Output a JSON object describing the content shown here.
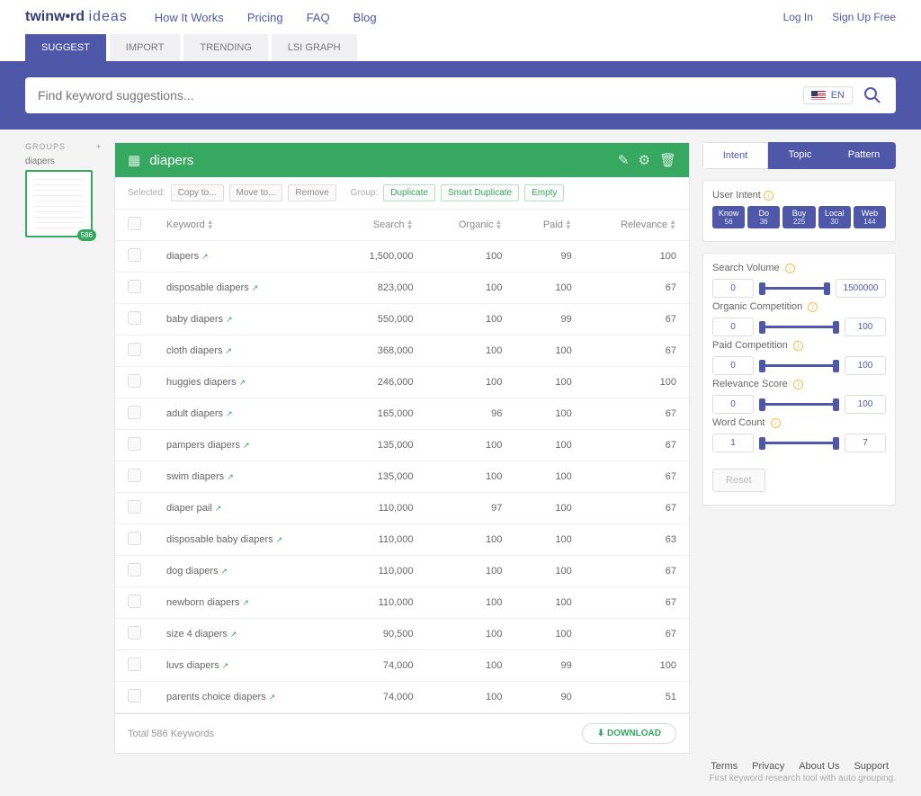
{
  "brand": {
    "name": "twinw•rd",
    "sub": "ideas"
  },
  "topnav": [
    "How It Works",
    "Pricing",
    "FAQ",
    "Blog"
  ],
  "auth": {
    "login": "Log In",
    "signup": "Sign Up Free"
  },
  "tabs": [
    "SUGGEST",
    "IMPORT",
    "TRENDING",
    "LSI GRAPH"
  ],
  "activeTab": 0,
  "search": {
    "placeholder": "Find keyword suggestions...",
    "lang": "EN"
  },
  "sidebar": {
    "label": "GROUPS",
    "item": "diapers",
    "badge": "586"
  },
  "header": {
    "title": "diapers"
  },
  "toolbar": {
    "selected": "Selected:",
    "b1": "Copy to...",
    "b2": "Move to...",
    "b3": "Remove",
    "group": "Group:",
    "g1": "Duplicate",
    "g2": "Smart Duplicate",
    "g3": "Empty"
  },
  "cols": {
    "keyword": "Keyword",
    "search": "Search",
    "organic": "Organic",
    "paid": "Paid",
    "relevance": "Relevance"
  },
  "rows": [
    {
      "k": "diapers",
      "s": "1,500,000",
      "o": "100",
      "p": "99",
      "r": "100"
    },
    {
      "k": "disposable diapers",
      "s": "823,000",
      "o": "100",
      "p": "100",
      "r": "67"
    },
    {
      "k": "baby diapers",
      "s": "550,000",
      "o": "100",
      "p": "99",
      "r": "67"
    },
    {
      "k": "cloth diapers",
      "s": "368,000",
      "o": "100",
      "p": "100",
      "r": "67"
    },
    {
      "k": "huggies diapers",
      "s": "246,000",
      "o": "100",
      "p": "100",
      "r": "100"
    },
    {
      "k": "adult diapers",
      "s": "165,000",
      "o": "96",
      "p": "100",
      "r": "67"
    },
    {
      "k": "pampers diapers",
      "s": "135,000",
      "o": "100",
      "p": "100",
      "r": "67"
    },
    {
      "k": "swim diapers",
      "s": "135,000",
      "o": "100",
      "p": "100",
      "r": "67"
    },
    {
      "k": "diaper pail",
      "s": "110,000",
      "o": "97",
      "p": "100",
      "r": "67"
    },
    {
      "k": "disposable baby diapers",
      "s": "110,000",
      "o": "100",
      "p": "100",
      "r": "63"
    },
    {
      "k": "dog diapers",
      "s": "110,000",
      "o": "100",
      "p": "100",
      "r": "67"
    },
    {
      "k": "newborn diapers",
      "s": "110,000",
      "o": "100",
      "p": "100",
      "r": "67"
    },
    {
      "k": "size 4 diapers",
      "s": "90,500",
      "o": "100",
      "p": "100",
      "r": "67"
    },
    {
      "k": "luvs diapers",
      "s": "74,000",
      "o": "100",
      "p": "99",
      "r": "100"
    },
    {
      "k": "parents choice diapers",
      "s": "74,000",
      "o": "100",
      "p": "90",
      "r": "51"
    }
  ],
  "footerTable": {
    "total": "Total 586 Keywords",
    "download": "DOWNLOAD"
  },
  "rightTabs": [
    "Intent",
    "Topic",
    "Pattern"
  ],
  "intent": {
    "label": "User Intent",
    "chips": [
      {
        "t": "Know",
        "n": "56"
      },
      {
        "t": "Do",
        "n": "36"
      },
      {
        "t": "Buy",
        "n": "225"
      },
      {
        "t": "Local",
        "n": "30"
      },
      {
        "t": "Web",
        "n": "144"
      }
    ]
  },
  "filters": [
    {
      "label": "Search Volume",
      "min": "0",
      "max": "1500000"
    },
    {
      "label": "Organic Competition",
      "min": "0",
      "max": "100"
    },
    {
      "label": "Paid Competition",
      "min": "0",
      "max": "100"
    },
    {
      "label": "Relevance Score",
      "min": "0",
      "max": "100"
    },
    {
      "label": "Word Count",
      "min": "1",
      "max": "7"
    }
  ],
  "reset": "Reset",
  "footer": {
    "links": [
      "Terms",
      "Privacy",
      "About Us",
      "Support"
    ],
    "sub": "First keyword research tool with auto grouping."
  }
}
